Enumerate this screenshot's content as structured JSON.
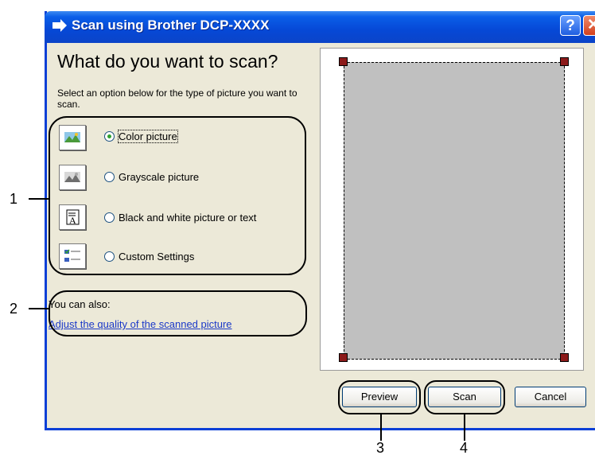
{
  "window": {
    "title": "Scan using Brother DCP-XXXX",
    "help_label": "?",
    "close_label": "✕"
  },
  "main": {
    "heading": "What do you want to scan?",
    "instructions": "Select an option below for the type of picture you want to scan.",
    "options": [
      {
        "label": "Color picture",
        "selected": true,
        "icon": "color-picture-icon"
      },
      {
        "label": "Grayscale picture",
        "selected": false,
        "icon": "grayscale-picture-icon"
      },
      {
        "label": "Black and white picture or text",
        "selected": false,
        "icon": "bw-picture-text-icon"
      },
      {
        "label": "Custom Settings",
        "selected": false,
        "icon": "custom-settings-icon"
      }
    ],
    "also_label": "You can also:",
    "adjust_link": "Adjust the quality of the scanned picture"
  },
  "buttons": {
    "preview": "Preview",
    "scan": "Scan",
    "cancel": "Cancel"
  },
  "callouts": [
    "1",
    "2",
    "3",
    "4"
  ],
  "colors": {
    "titlebar": "#0648d6",
    "dialog_bg": "#ece9d8",
    "link": "#1a38c8",
    "selection_handle": "#8c1a1a",
    "preview_bg": "#c0c0c0"
  }
}
